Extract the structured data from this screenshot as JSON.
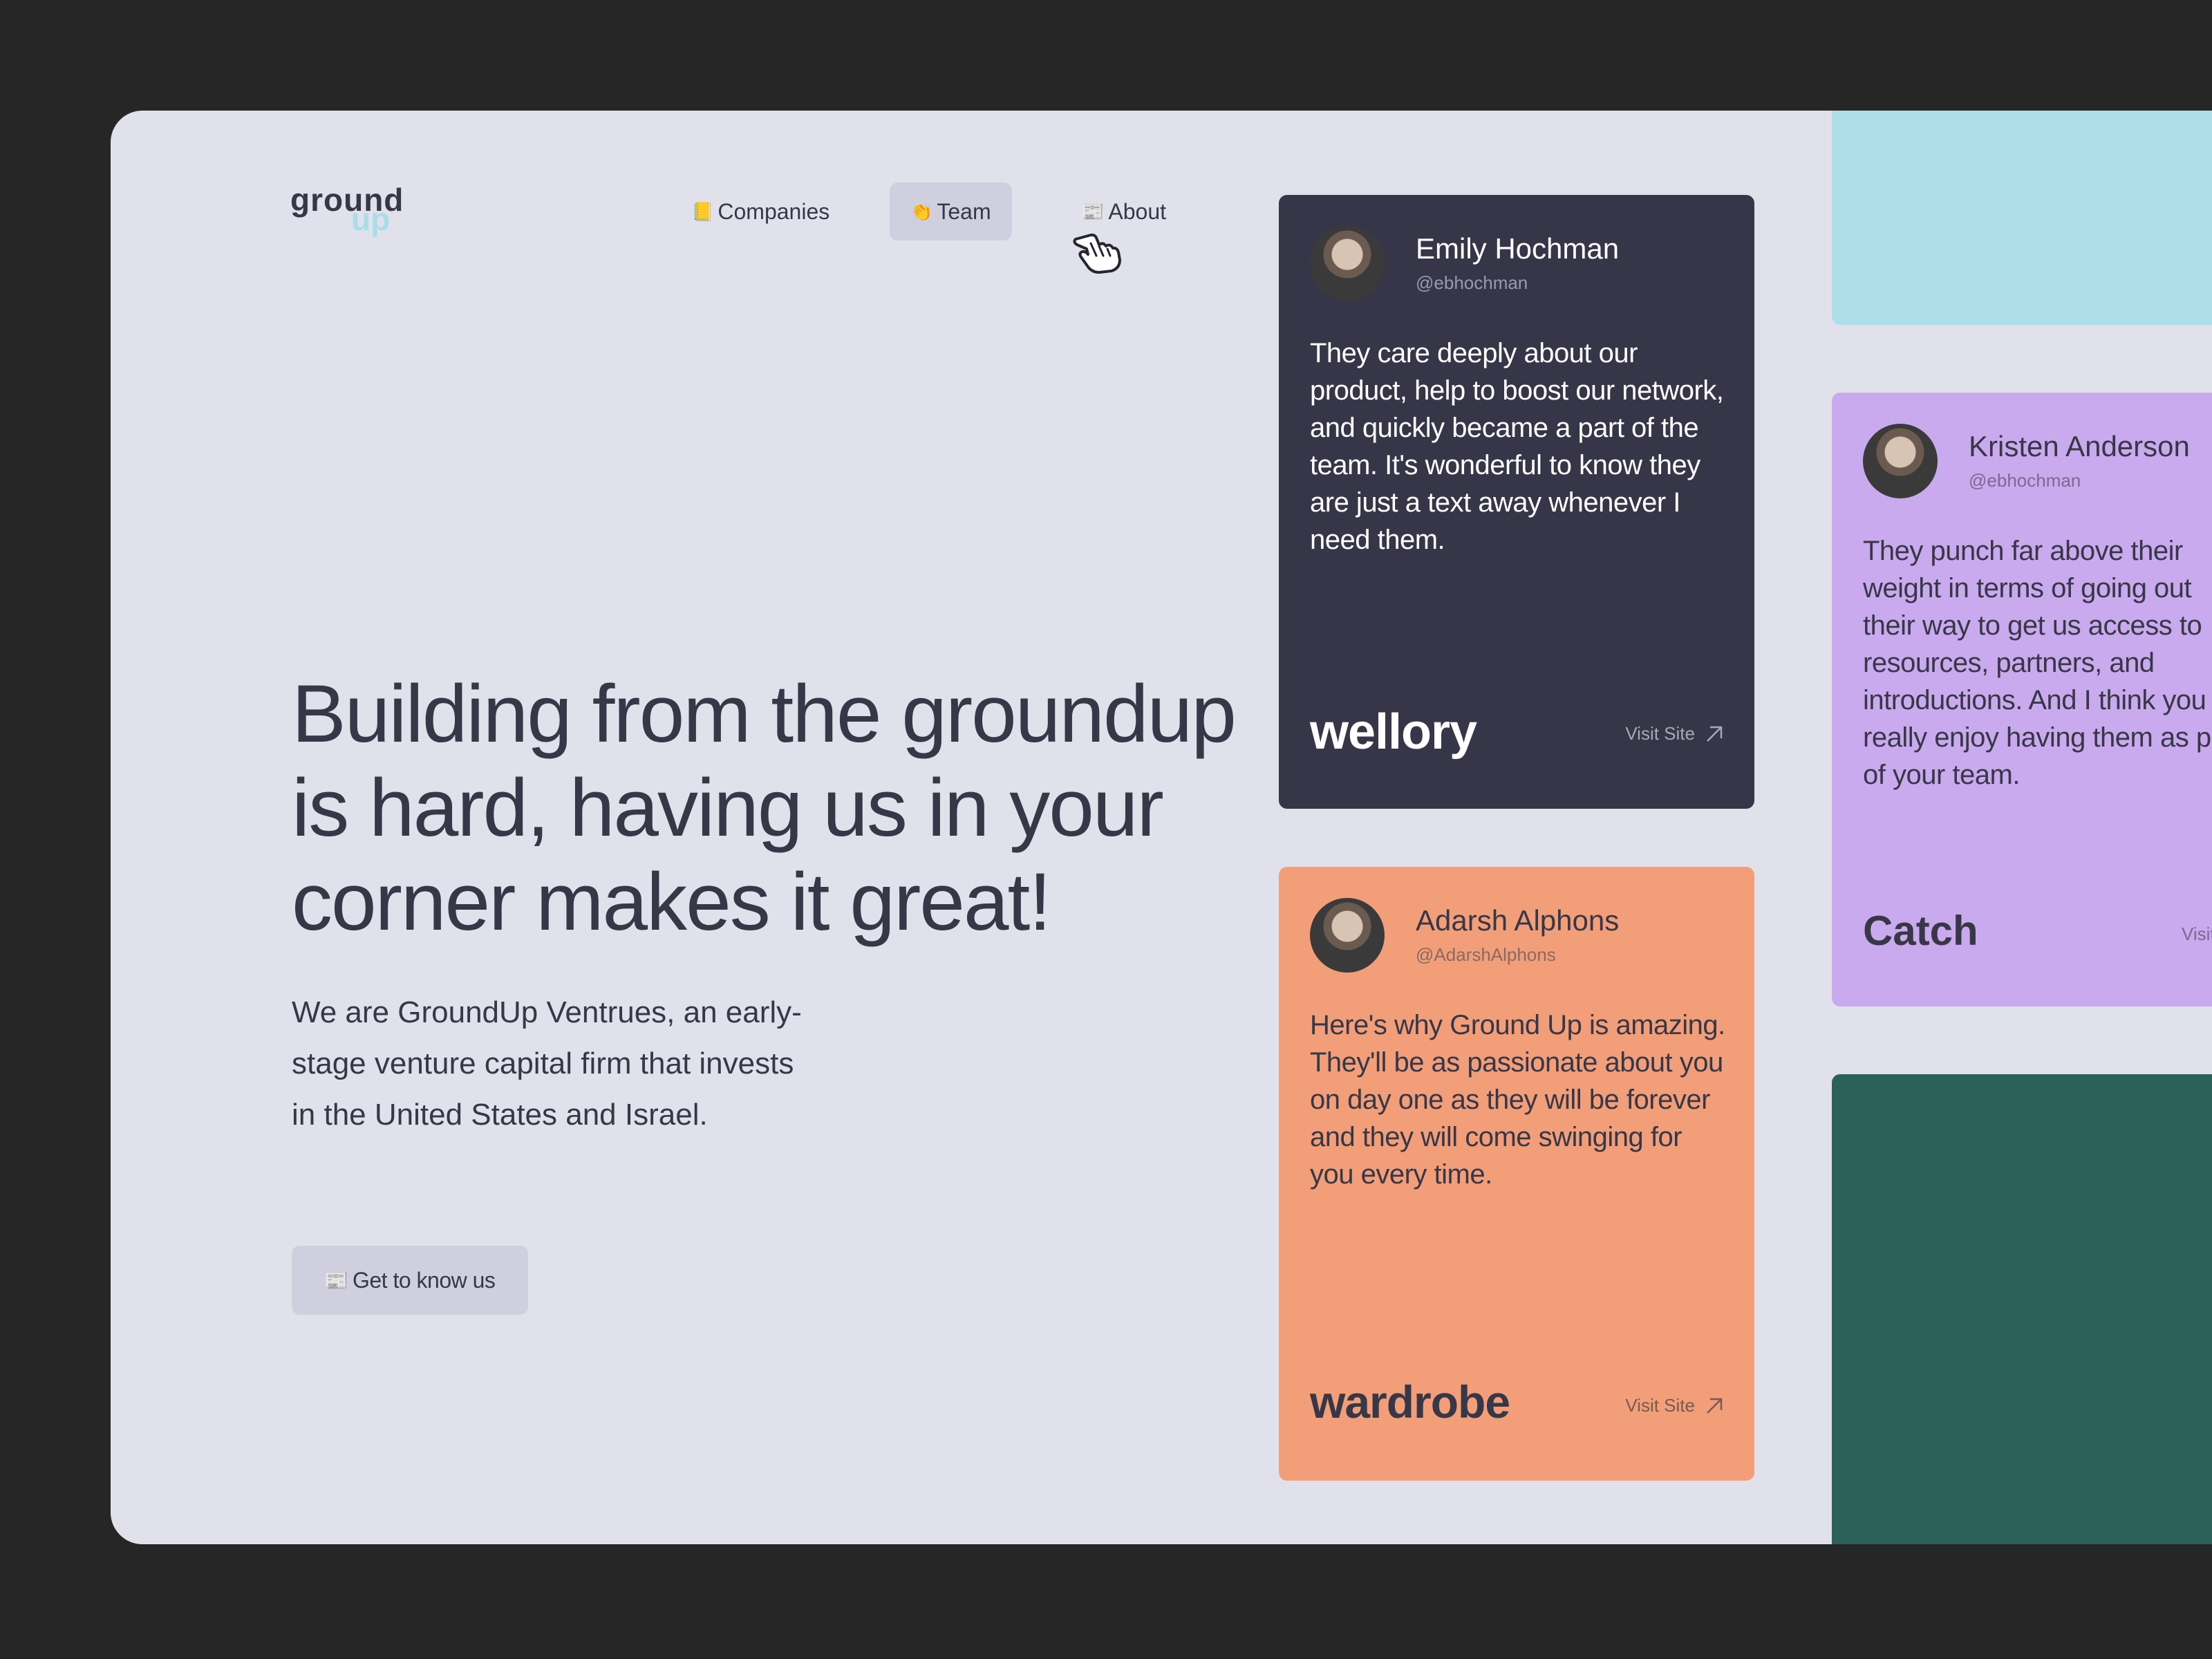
{
  "logo": {
    "line1": "ground",
    "line2": "up"
  },
  "nav": {
    "companies": {
      "emoji": "📒",
      "label": "Companies"
    },
    "team": {
      "emoji": "👏",
      "label": "Team"
    },
    "about": {
      "emoji": "📰",
      "label": "About"
    }
  },
  "hero": {
    "headline": "Building from the groundup is hard, having us in your corner makes it great!",
    "description": "We are GroundUp Ventrues, an early-stage venture capital firm that invests in the United States and Israel.",
    "cta_emoji": "📰",
    "cta_label": "Get to know us"
  },
  "testimonials": [
    {
      "name": "Emily Hochman",
      "handle": "@ebhochman",
      "quote": "They care deeply about our product, help to boost our network, and quickly became a part of the team. It's wonderful to know they are just a text away whenever I need them.",
      "company": "wellory",
      "visit_label": "Visit Site",
      "bg_color": "#363648"
    },
    {
      "name": "Adarsh Alphons",
      "handle": "@AdarshAlphons",
      "quote": "Here's why Ground Up is amazing. They'll be as passionate about you on day one as they will be forever and they will come swinging for you every time.",
      "company": "wardrobe",
      "visit_label": "Visit Site",
      "bg_color": "#f29e79"
    },
    {
      "name": "Kristen Anderson",
      "handle": "@ebhochman",
      "quote_lines": [
        "They punch far above their",
        "weight in terms of going out",
        "their way to get us access to",
        "resources, partners, and",
        "introductions. And I think you",
        "really enjoy having them as p",
        "of your team."
      ],
      "company": "Catch",
      "visit_label": "Visit",
      "bg_color": "#caaaee"
    }
  ],
  "colors": {
    "page_bg": "#262626",
    "frame_bg": "#e1e1ec",
    "text_dark": "#373747",
    "cyan_card": "#aedfe9",
    "green_card": "#2b6159",
    "active_nav": "#cfcfe0"
  }
}
